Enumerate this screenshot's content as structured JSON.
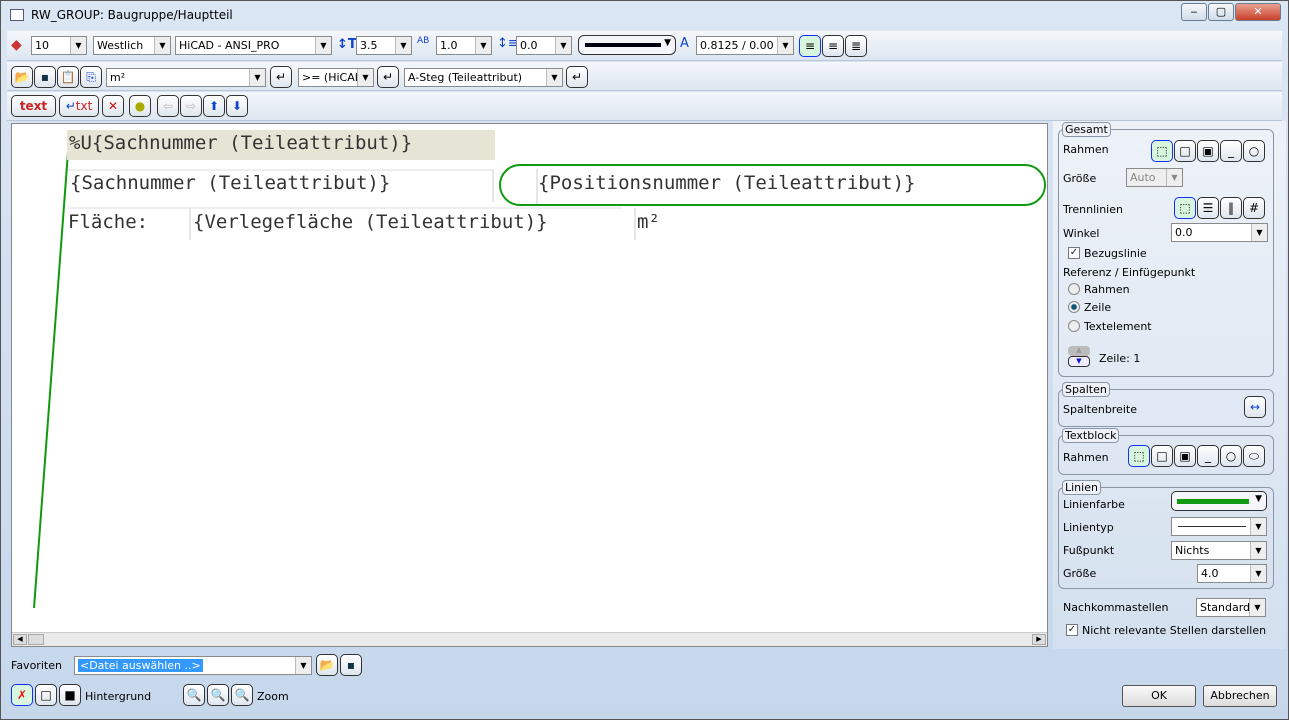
{
  "window": {
    "title": "RW_GROUP: Baugruppe/Hauptteil",
    "minimize": "‒",
    "maximize": "▢",
    "close": "✕"
  },
  "toolbar1": {
    "layer": "10",
    "direction": "Westlich",
    "font": "HiCAD - ANSI_PRO",
    "height": "3.5",
    "spacing": "1.0",
    "line_spacing": "0.0",
    "ratio": "0.8125 / 0.00"
  },
  "toolbar2": {
    "unit": "m²",
    "operator": ">= (HiCAD",
    "attribute": "A-Steg (Teileattribut)"
  },
  "toolbar3": {
    "text_btn": "text",
    "txt_btn": "txt"
  },
  "canvas": {
    "row1": "%U{Sachnummer (Teileattribut)}",
    "row2a": "{Sachnummer (Teileattribut)}",
    "row2b": "{Positionsnummer (Teileattribut)}",
    "row3a": "Fläche:",
    "row3b": "{Verlegefläche (Teileattribut)}",
    "row3c": "m²",
    "line_color": "#119911"
  },
  "panel": {
    "gesamt": {
      "legend": "Gesamt",
      "rahmen": "Rahmen",
      "groesse": "Größe",
      "groesse_value": "Auto",
      "trennlinien": "Trennlinien",
      "winkel": "Winkel",
      "winkel_value": "0.0",
      "bezugslinie": "Bezugslinie",
      "referenz": "Referenz / Einfügepunkt",
      "radio_rahmen": "Rahmen",
      "radio_zeile": "Zeile",
      "radio_textelement": "Textelement",
      "zeile": "Zeile: 1"
    },
    "spalten": {
      "legend": "Spalten",
      "spaltenbreite": "Spaltenbreite"
    },
    "textblock": {
      "legend": "Textblock",
      "rahmen": "Rahmen"
    },
    "linien": {
      "legend": "Linien",
      "linienfarbe": "Linienfarbe",
      "linientyp": "Linientyp",
      "fusspunkt": "Fußpunkt",
      "fusspunkt_value": "Nichts",
      "groesse": "Größe",
      "groesse_value": "4.0"
    },
    "nachkommastellen": "Nachkommastellen",
    "nachkommastellen_value": "Standard",
    "nicht_relevante": "Nicht relevante Stellen darstellen"
  },
  "bottom": {
    "favoriten": "Favoriten",
    "datei": "<Datei auswählen ..>",
    "hintergrund": "Hintergrund",
    "zoom": "Zoom",
    "ok": "OK",
    "cancel": "Abbrechen"
  }
}
